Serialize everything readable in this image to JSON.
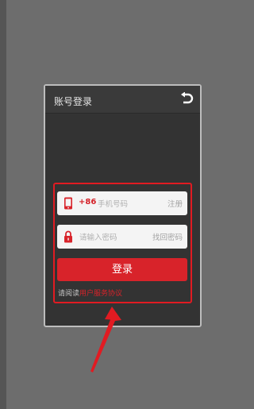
{
  "dialog": {
    "title": "账号登录",
    "back_icon": "undo-arrow-icon"
  },
  "form": {
    "phone": {
      "country_code": "+86",
      "placeholder": "手机号码",
      "right_link": "注册",
      "icon": "mobile-phone-icon"
    },
    "password": {
      "placeholder": "请输入密码",
      "right_link": "找回密码",
      "icon": "lock-icon"
    },
    "submit_label": "登录",
    "agreement_text": "请阅读",
    "agreement_link": "用户服务协议"
  },
  "colors": {
    "accent": "#d8232a",
    "dialog_bg": "#333333",
    "page_bg": "#6d6d6d"
  }
}
